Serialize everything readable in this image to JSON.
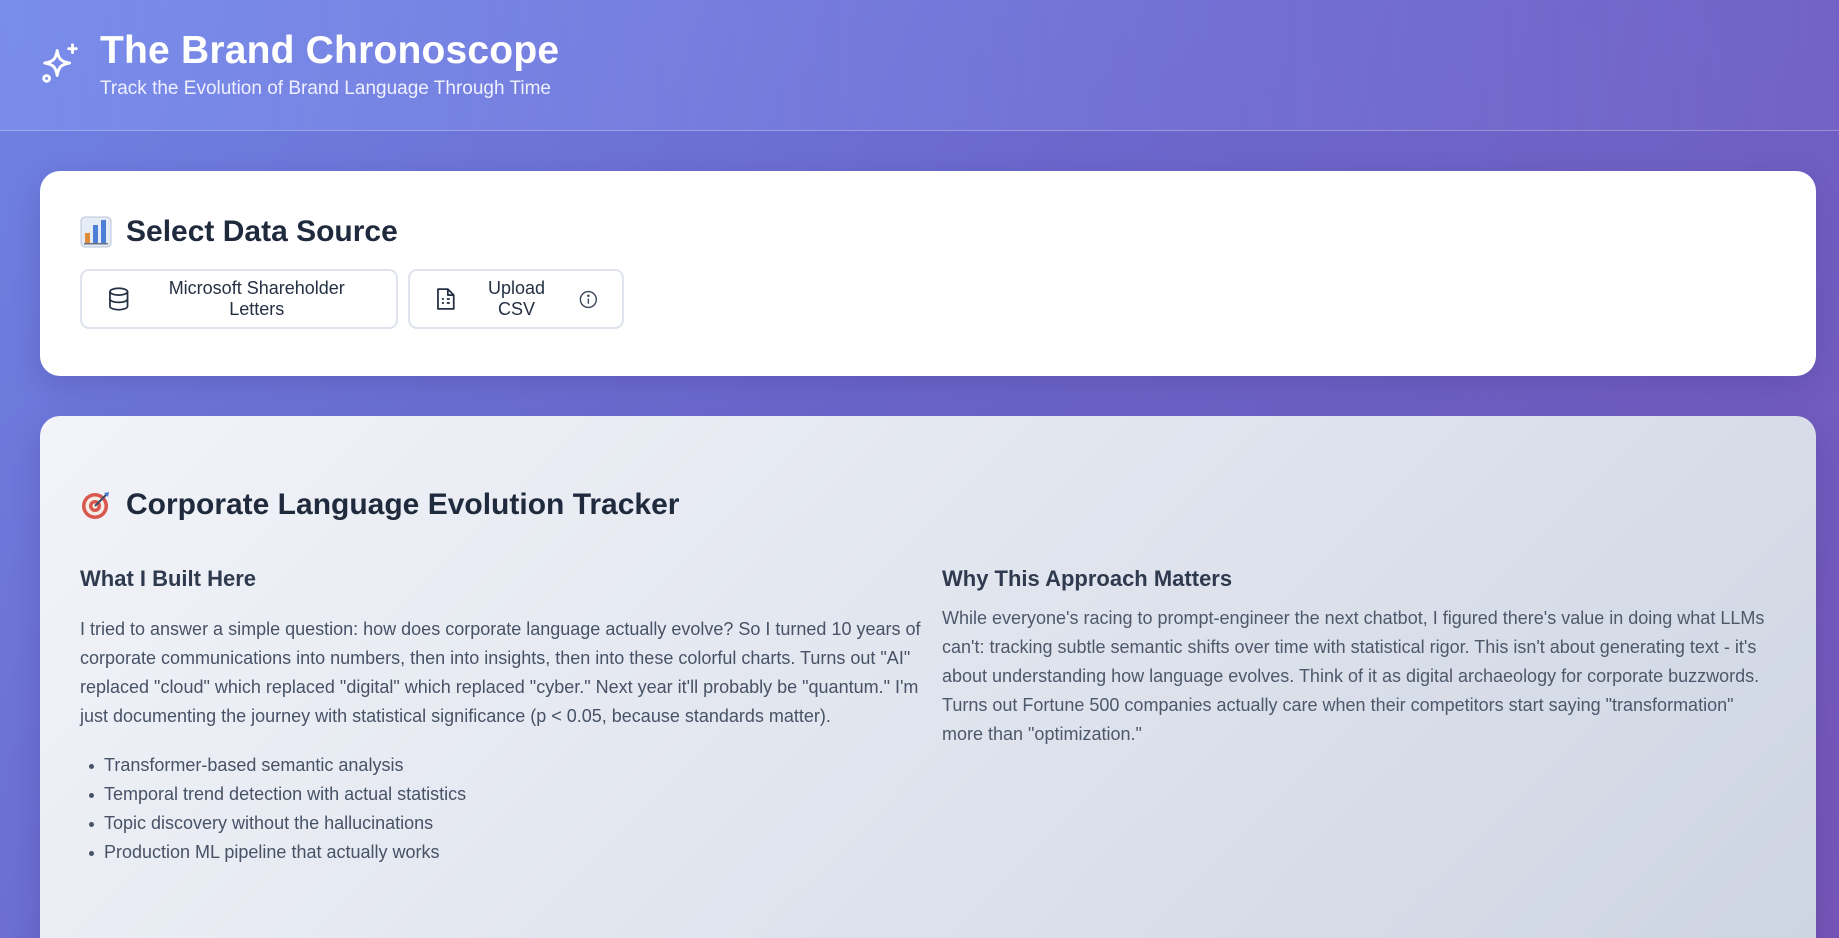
{
  "header": {
    "logo_icon": "sparkles-icon",
    "title": "The Brand Chronoscope",
    "subtitle": "Track the Evolution of Brand Language Through Time"
  },
  "data_source": {
    "heading_icon": "bar-chart-emoji-icon",
    "heading": "Select Data Source",
    "buttons": [
      {
        "label": "Microsoft Shareholder Letters",
        "icon": "database-icon"
      },
      {
        "label": "Upload CSV",
        "icon": "file-spreadsheet-icon",
        "trailing_icon": "info-icon"
      }
    ]
  },
  "tracker": {
    "heading_icon": "target-emoji-icon",
    "heading": "Corporate Language Evolution Tracker",
    "left": {
      "title": "What I Built Here",
      "body": "I tried to answer a simple question: how does corporate language actually evolve? So I turned 10 years of corporate communications into numbers, then into insights, then into these colorful charts. Turns out \"AI\" replaced \"cloud\" which replaced \"digital\" which replaced \"cyber.\" Next year it'll probably be \"quantum.\" I'm just documenting the journey with statistical significance (p < 0.05, because standards matter).",
      "features": [
        "Transformer-based semantic analysis",
        "Temporal trend detection with actual statistics",
        "Topic discovery without the hallucinations",
        "Production ML pipeline that actually works"
      ]
    },
    "right": {
      "title": "Why This Approach Matters",
      "body": "While everyone's racing to prompt-engineer the next chatbot, I figured there's value in doing what LLMs can't: tracking subtle semantic shifts over time with statistical rigor. This isn't about generating text - it's about understanding how language evolves. Think of it as digital archaeology for corporate buzzwords. Turns out Fortune 500 companies actually care when their competitors start saying \"transformation\" more than \"optimization.\""
    }
  },
  "colors": {
    "background_start": "#6f82e4",
    "background_end": "#7656b8",
    "heading_text": "#1f2a3d",
    "body_text": "#475266"
  }
}
